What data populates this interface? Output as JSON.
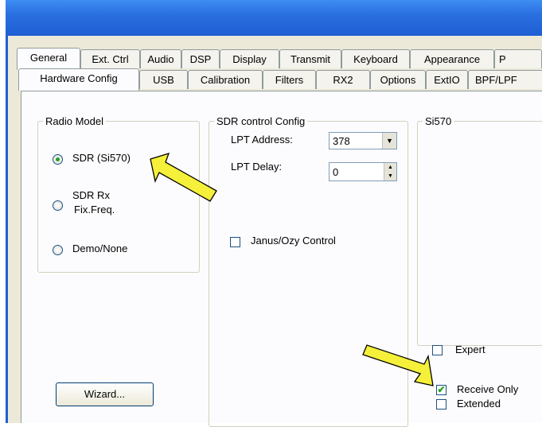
{
  "tabs_row1": [
    "General",
    "Ext. Ctrl",
    "Audio",
    "DSP",
    "Display",
    "Transmit",
    "Keyboard",
    "Appearance",
    "P"
  ],
  "tabs_row2": [
    "Hardware Config",
    "USB",
    "Calibration",
    "Filters",
    "RX2",
    "Options",
    "ExtIO",
    "BPF/LPF"
  ],
  "radio_model": {
    "legend": "Radio Model",
    "option1": "SDR (Si570)",
    "option2_line1": "SDR Rx",
    "option2_line2": "Fix.Freq.",
    "option3": "Demo/None",
    "selected": "SDR (Si570)"
  },
  "sdr_control": {
    "legend": "SDR control Config",
    "lpt_address_label": "LPT Address:",
    "lpt_address_value": "378",
    "lpt_delay_label": "LPT Delay:",
    "lpt_delay_value": "0",
    "janus_label": "Janus/Ozy Control"
  },
  "si570": {
    "legend": "Si570",
    "expert_label": "Expert",
    "receive_only_label": "Receive Only",
    "receive_only_checked": true,
    "extended_label": "Extended"
  },
  "wizard_label": "Wizard...",
  "colors": {
    "titlebar": "#2a6fe0",
    "window_bg": "#ece9d8",
    "arrow": "#f5f03a"
  }
}
